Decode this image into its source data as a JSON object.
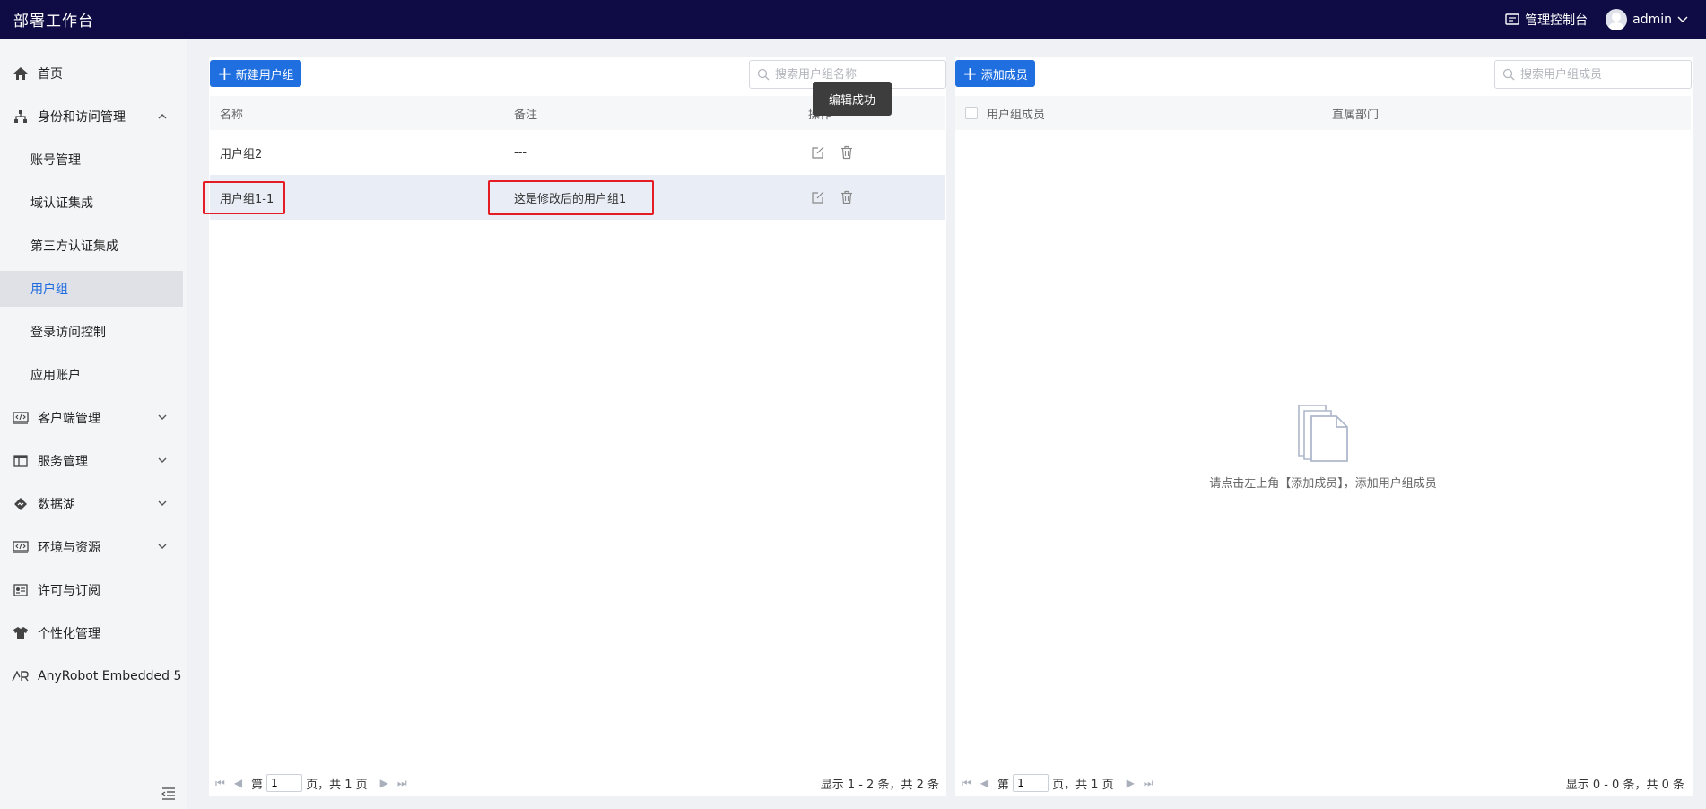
{
  "app": {
    "title": "部署工作台"
  },
  "topbar": {
    "console_label": "管理控制台",
    "user_name": "admin"
  },
  "sidebar": {
    "items": [
      {
        "label": "首页"
      },
      {
        "label": "身份和访问管理"
      },
      {
        "label": "账号管理"
      },
      {
        "label": "域认证集成"
      },
      {
        "label": "第三方认证集成"
      },
      {
        "label": "用户组"
      },
      {
        "label": "登录访问控制"
      },
      {
        "label": "应用账户"
      },
      {
        "label": "客户端管理"
      },
      {
        "label": "服务管理"
      },
      {
        "label": "数据湖"
      },
      {
        "label": "环境与资源"
      },
      {
        "label": "许可与订阅"
      },
      {
        "label": "个性化管理"
      },
      {
        "label": "AnyRobot Embedded 5"
      }
    ]
  },
  "groups_panel": {
    "new_button_label": "新建用户组",
    "search_placeholder": "搜索用户组名称",
    "columns": [
      "名称",
      "备注",
      "操作"
    ],
    "rows": [
      {
        "name": "用户组2",
        "remark": "---"
      },
      {
        "name": "用户组1-1",
        "remark": "这是修改后的用户组1"
      }
    ],
    "pager": {
      "prefix": "第",
      "page": "1",
      "suffix": "页，共 1 页",
      "info": "显示 1 - 2 条，共 2 条"
    }
  },
  "tooltip": {
    "text": "编辑成功"
  },
  "members_panel": {
    "add_button_label": "添加成员",
    "search_placeholder": "搜索用户组成员",
    "columns": [
      "用户组成员",
      "直属部门"
    ],
    "empty_text": "请点击左上角【添加成员】，添加用户组成员",
    "pager": {
      "prefix": "第",
      "page": "1",
      "suffix": "页，共 1 页",
      "info": "显示 0 - 0 条，共 0 条"
    }
  },
  "colors": {
    "topbar": "#0f0c45",
    "primary": "#1f6fe0",
    "highlight_border": "#e51c23",
    "active_row": "#e9eef6"
  }
}
